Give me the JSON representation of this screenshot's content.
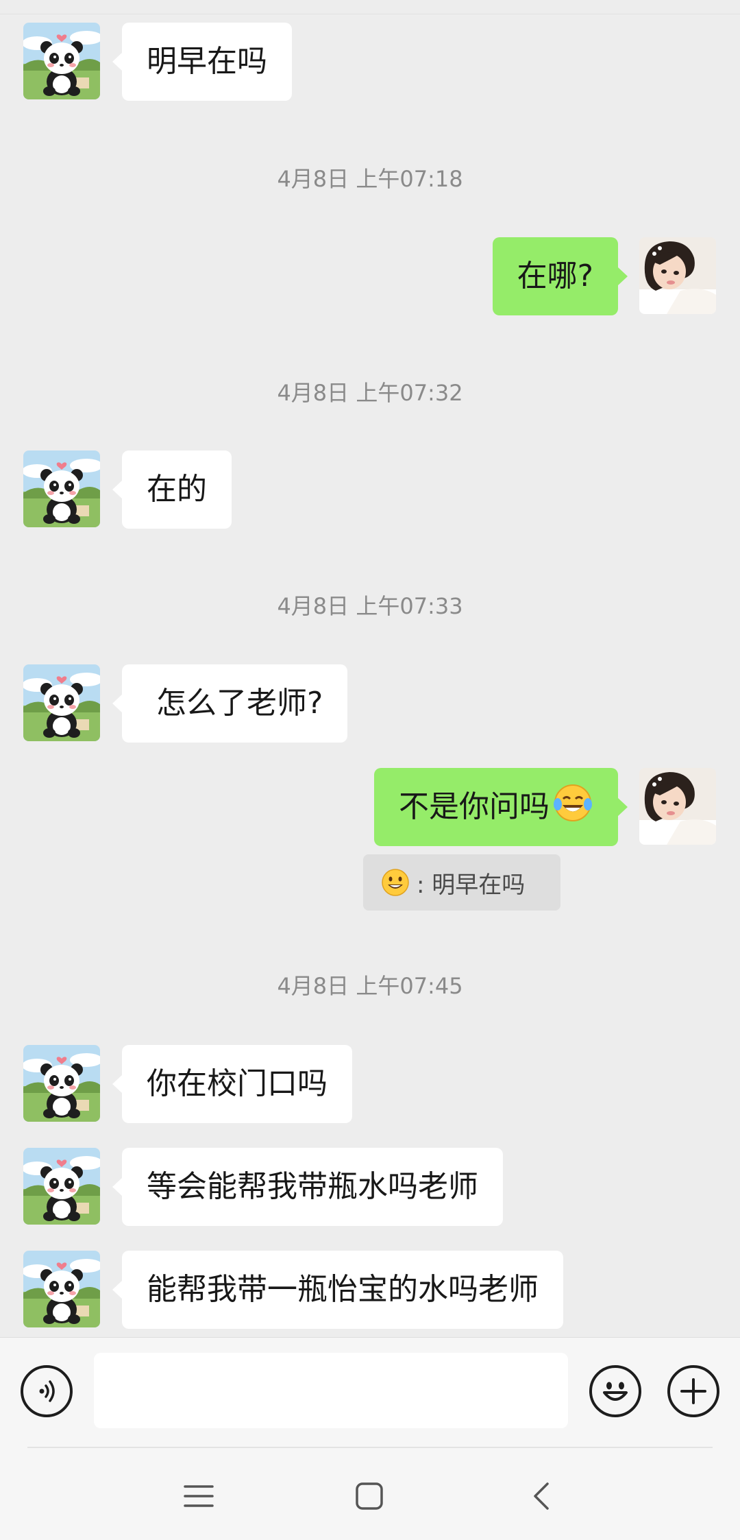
{
  "messages": [
    {
      "side": "in",
      "text": "明早在吗"
    },
    {
      "side": "out",
      "text": "在哪?"
    },
    {
      "side": "in",
      "text": "在的"
    },
    {
      "side": "in",
      "text": "怎么了老师?"
    },
    {
      "side": "out",
      "text": "不是你问吗"
    },
    {
      "side": "in",
      "text": "你在校门口吗"
    },
    {
      "side": "in",
      "text": "等会能帮我带瓶水吗老师"
    },
    {
      "side": "in",
      "text": "能帮我带一瓶怡宝的水吗老师"
    }
  ],
  "timestamps": [
    "4月8日 上午07:18",
    "4月8日 上午07:32",
    "4月8日 上午07:33",
    "4月8日 上午07:45"
  ],
  "quote": {
    "text": ": 明早在吗",
    "emoji_icon": "grinning-face-emoji"
  },
  "inline_emoji": "tears-of-joy-emoji",
  "input": {
    "placeholder": "",
    "value": ""
  },
  "colors": {
    "background": "#ededed",
    "incoming_bubble": "#ffffff",
    "outgoing_bubble": "#95ec69",
    "timestamp": "#8a8a8a"
  },
  "icons": [
    "voice-icon",
    "emoji-icon",
    "plus-icon",
    "menu-icon",
    "home-icon",
    "back-icon"
  ]
}
